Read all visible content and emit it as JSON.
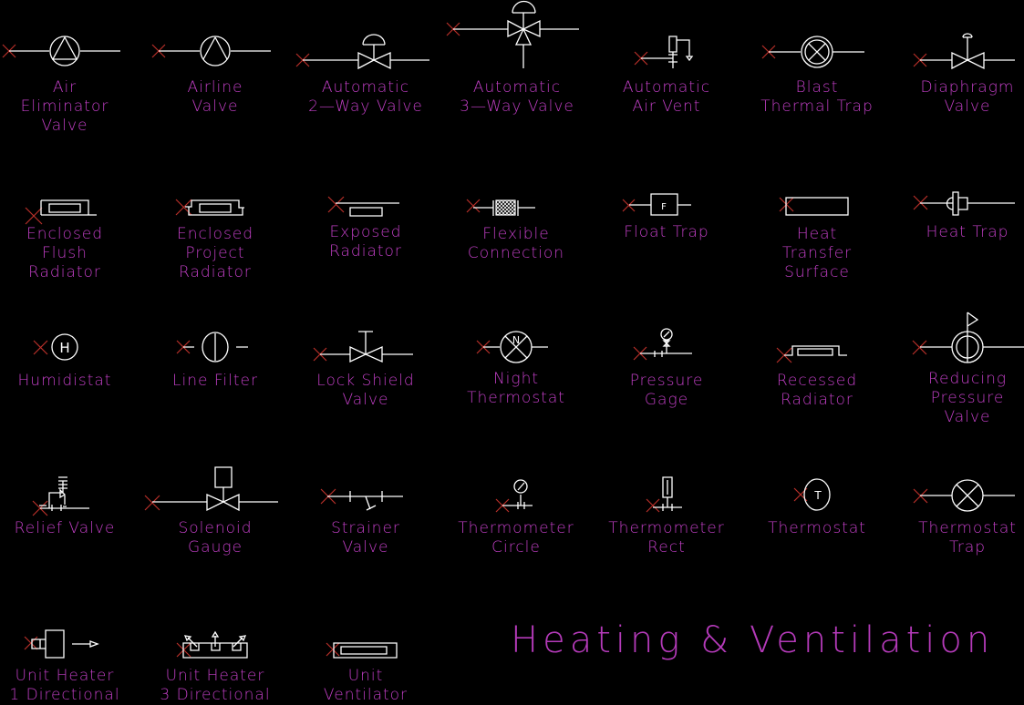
{
  "drawing_title": "Heating & Ventilation",
  "colors": {
    "background": "#000000",
    "symbol": "#ffffff",
    "label": "#c23fc6",
    "insert_marker": "#b8302a"
  },
  "symbols": [
    {
      "id": "air-eliminator-valve",
      "lines": [
        "Air",
        "Eliminator",
        "Valve"
      ]
    },
    {
      "id": "airline-valve",
      "lines": [
        "Airline",
        "Valve"
      ]
    },
    {
      "id": "automatic-2-way-valve",
      "lines": [
        "Automatic",
        "2—Way Valve"
      ]
    },
    {
      "id": "automatic-3-way-valve",
      "lines": [
        "Automatic",
        "3—Way Valve"
      ]
    },
    {
      "id": "automatic-air-vent",
      "lines": [
        "Automatic",
        "Air Vent"
      ]
    },
    {
      "id": "blast-thermal-trap",
      "lines": [
        "Blast",
        "Thermal Trap"
      ]
    },
    {
      "id": "diaphragm-valve",
      "lines": [
        "Diaphragm",
        "Valve"
      ]
    },
    {
      "id": "enclosed-flush-radiator",
      "lines": [
        "Enclosed",
        "Flush",
        "Radiator"
      ]
    },
    {
      "id": "enclosed-project-radiator",
      "lines": [
        "Enclosed",
        "Project",
        "Radiator"
      ]
    },
    {
      "id": "exposed-radiator",
      "lines": [
        "Exposed",
        "Radiator"
      ]
    },
    {
      "id": "flexible-connection",
      "lines": [
        "Flexible",
        "Connection"
      ]
    },
    {
      "id": "float-trap",
      "lines": [
        "Float Trap"
      ],
      "glyph": "F"
    },
    {
      "id": "heat-transfer-surface",
      "lines": [
        "Heat",
        "Transfer",
        "Surface"
      ]
    },
    {
      "id": "heat-trap",
      "lines": [
        "Heat Trap"
      ]
    },
    {
      "id": "humidistat",
      "lines": [
        "Humidistat"
      ],
      "glyph": "H"
    },
    {
      "id": "line-filter",
      "lines": [
        "Line Filter"
      ]
    },
    {
      "id": "lock-shield-valve",
      "lines": [
        "Lock Shield",
        "Valve"
      ]
    },
    {
      "id": "night-thermostat",
      "lines": [
        "Night",
        "Thermostat"
      ],
      "glyph": "N"
    },
    {
      "id": "pressure-gage",
      "lines": [
        "Pressure",
        "Gage"
      ]
    },
    {
      "id": "recessed-radiator",
      "lines": [
        "Recessed",
        "Radiator"
      ]
    },
    {
      "id": "reducing-pressure-valve",
      "lines": [
        "Reducing",
        "Pressure",
        "Valve"
      ]
    },
    {
      "id": "relief-valve",
      "lines": [
        "Relief Valve"
      ]
    },
    {
      "id": "solenoid-gauge",
      "lines": [
        "Solenoid",
        "Gauge"
      ]
    },
    {
      "id": "strainer-valve",
      "lines": [
        "Strainer",
        "Valve"
      ]
    },
    {
      "id": "thermometer-circle",
      "lines": [
        "Thermometer",
        "Circle"
      ]
    },
    {
      "id": "thermometer-rect",
      "lines": [
        "Thermometer",
        "Rect"
      ]
    },
    {
      "id": "thermostat",
      "lines": [
        "Thermostat"
      ],
      "glyph": "T"
    },
    {
      "id": "thermostat-trap",
      "lines": [
        "Thermostat",
        "Trap"
      ]
    },
    {
      "id": "unit-heater-1-directional",
      "lines": [
        "Unit Heater",
        "1 Directional"
      ]
    },
    {
      "id": "unit-heater-3-directional",
      "lines": [
        "Unit Heater",
        "3 Directional"
      ]
    },
    {
      "id": "unit-ventilator",
      "lines": [
        "Unit",
        "Ventilator"
      ]
    }
  ]
}
